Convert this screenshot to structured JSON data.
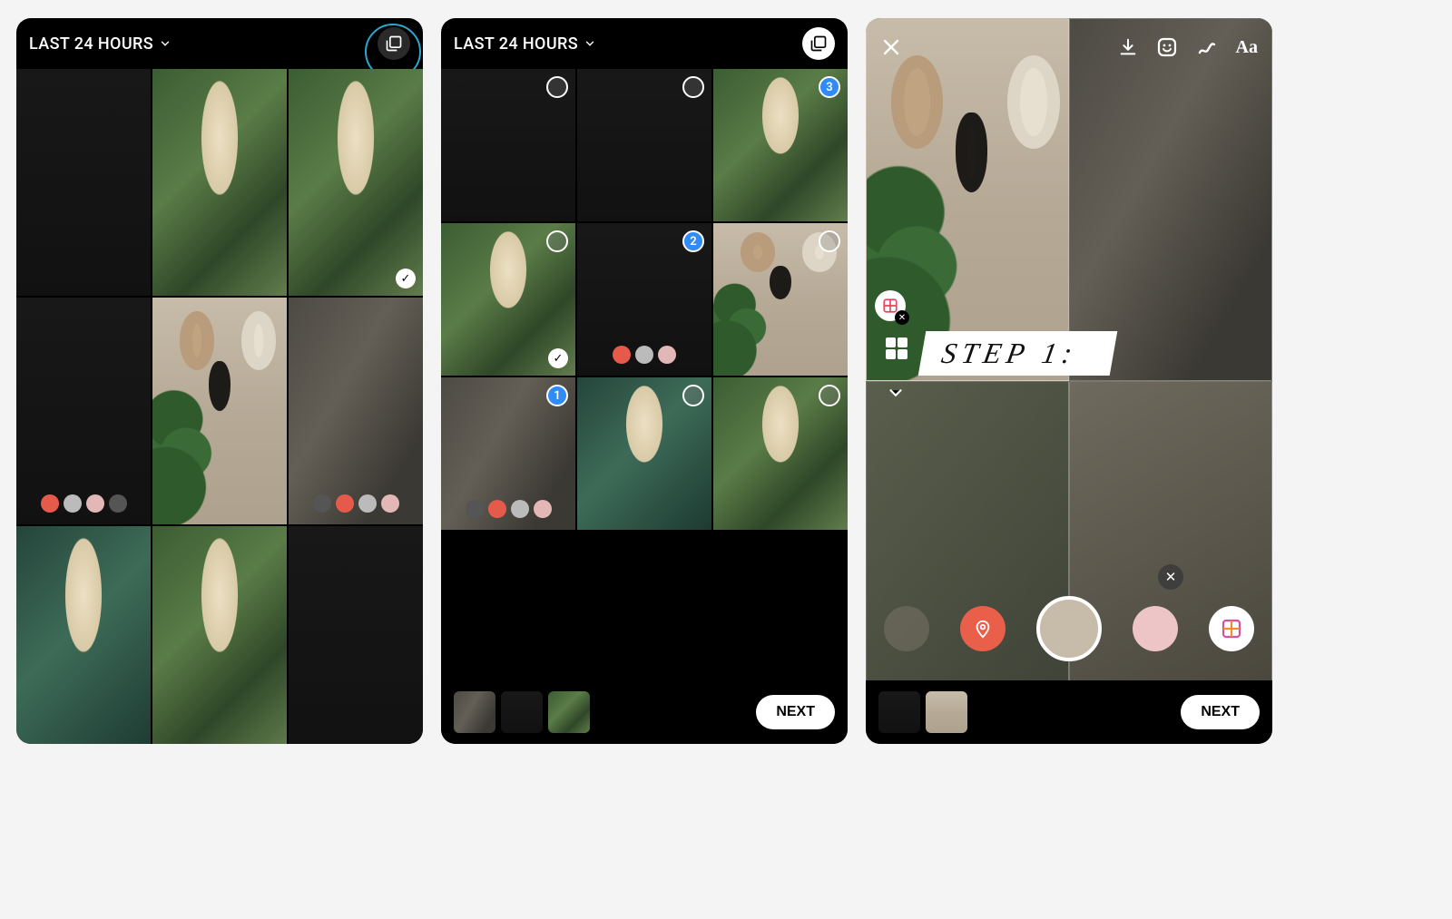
{
  "phone1": {
    "album_label": "LAST 24 HOURS",
    "multi_select_active": false
  },
  "phone2": {
    "album_label": "LAST 24 HOURS",
    "multi_select_active": true,
    "selected_badges": [
      "1",
      "2",
      "3"
    ],
    "next_label": "NEXT"
  },
  "phone3": {
    "step_text": "STEP 1:",
    "next_label": "NEXT"
  }
}
